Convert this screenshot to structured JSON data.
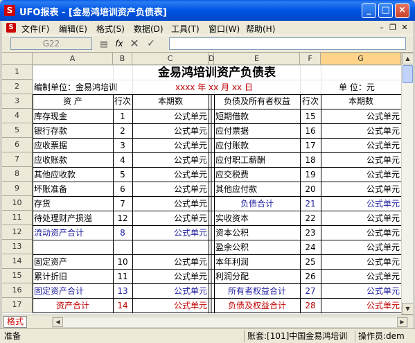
{
  "window": {
    "title": "UFO报表 - [金易鸿培训资产负债表]"
  },
  "menubar": {
    "items": [
      "文件(F)",
      "编辑(E)",
      "格式(S)",
      "数据(D)",
      "工具(T)",
      "窗口(W)",
      "帮助(H)"
    ]
  },
  "formulabar": {
    "cell_ref": "G22",
    "fx_label": "fx",
    "value": ""
  },
  "columns": [
    "A",
    "B",
    "C",
    "D",
    "E",
    "F",
    "G"
  ],
  "rows": [
    "1",
    "2",
    "3",
    "4",
    "5",
    "6",
    "7",
    "8",
    "9",
    "10",
    "11",
    "12",
    "13",
    "14",
    "15",
    "16",
    "17"
  ],
  "report": {
    "title": "金易鸿培训资产负债表",
    "unit_label": "编制单位：金易鸿培训",
    "date_label": "xxxx 年 xx 月 xx 日",
    "currency_label": "单  位：元"
  },
  "table": {
    "headers": [
      "资      产",
      "行次",
      "本期数",
      "负债及所有者权益",
      "行次",
      "本期数"
    ],
    "left": [
      {
        "name": "库存现金",
        "num": "1",
        "value": "公式单元"
      },
      {
        "name": "银行存款",
        "num": "2",
        "value": "公式单元"
      },
      {
        "name": "应收票据",
        "num": "3",
        "value": "公式单元"
      },
      {
        "name": "应收账款",
        "num": "4",
        "value": "公式单元"
      },
      {
        "name": "其他应收款",
        "num": "5",
        "value": "公式单元"
      },
      {
        "name": "坏账准备",
        "num": "6",
        "value": "公式单元"
      },
      {
        "name": "存货",
        "num": "7",
        "value": "公式单元"
      },
      {
        "name": "待处理财产损溢",
        "num": "12",
        "value": "公式单元"
      },
      {
        "name": "流动资产合计",
        "num": "8",
        "value": "公式单元"
      },
      {
        "name": "",
        "num": "",
        "value": ""
      },
      {
        "name": "固定资产",
        "num": "10",
        "value": "公式单元"
      },
      {
        "name": "累计折旧",
        "num": "11",
        "value": "公式单元"
      },
      {
        "name": "固定资产合计",
        "num": "13",
        "value": "公式单元"
      },
      {
        "name": "资产合计",
        "num": "14",
        "value": "公式单元"
      }
    ],
    "right": [
      {
        "name": "短期借款",
        "num": "15",
        "value": "公式单元"
      },
      {
        "name": "应付票据",
        "num": "16",
        "value": "公式单元"
      },
      {
        "name": "应付账款",
        "num": "17",
        "value": "公式单元"
      },
      {
        "name": "应付职工薪酬",
        "num": "18",
        "value": "公式单元"
      },
      {
        "name": "应交税费",
        "num": "19",
        "value": "公式单元"
      },
      {
        "name": "其他应付款",
        "num": "20",
        "value": "公式单元"
      },
      {
        "name": "负债合计",
        "num": "21",
        "value": "公式单元"
      },
      {
        "name": "实收资本",
        "num": "22",
        "value": "公式单元"
      },
      {
        "name": "资本公积",
        "num": "23",
        "value": "公式单元"
      },
      {
        "name": "盈余公积",
        "num": "24",
        "value": "公式单元"
      },
      {
        "name": "本年利润",
        "num": "25",
        "value": "公式单元"
      },
      {
        "name": "利润分配",
        "num": "26",
        "value": "公式单元"
      },
      {
        "name": "所有者权益合计",
        "num": "27",
        "value": "公式单元"
      },
      {
        "name": "负债及权益合计",
        "num": "28",
        "value": "公式单元"
      }
    ]
  },
  "sheet_tab": "格式",
  "status": {
    "mode": "准备",
    "account": "账套:[101]中国金易鸿培训",
    "operator": "操作员:dem"
  },
  "colors": {
    "blue_text": "#1e1ea0",
    "red_text": "#c00000",
    "selected_col": "#ffd48a"
  }
}
